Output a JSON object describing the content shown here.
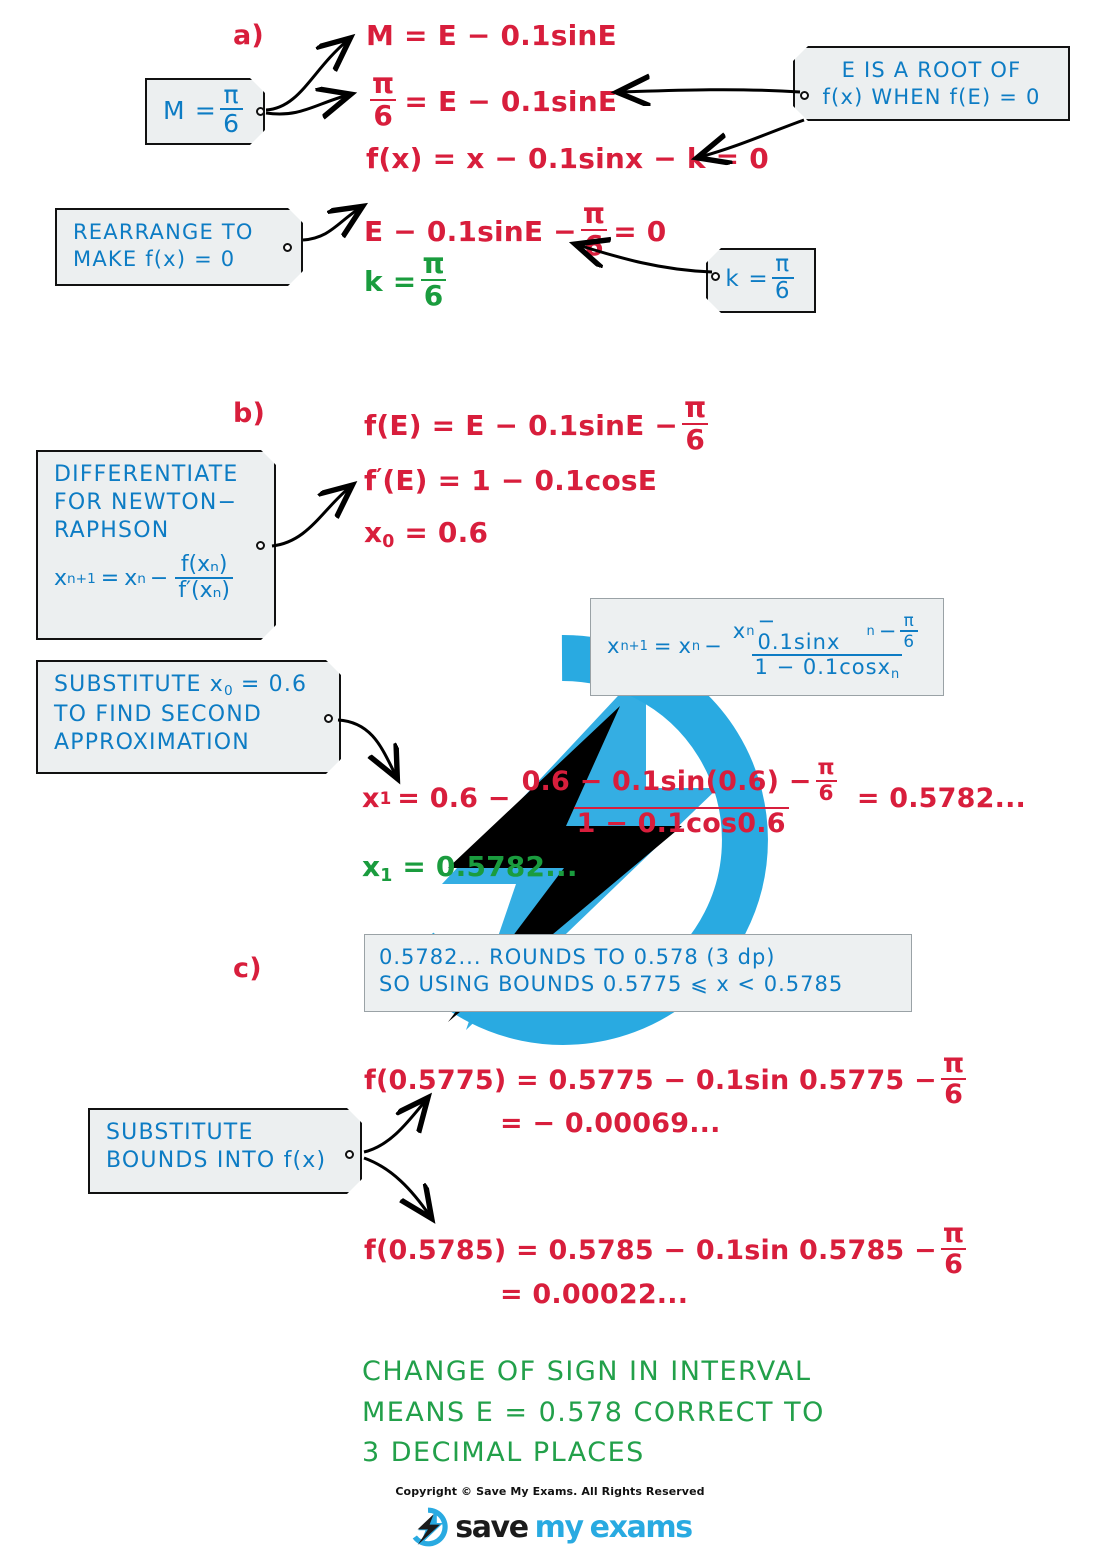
{
  "colors": {
    "working_red": "#d81e3c",
    "answer_green": "#1a9c3e",
    "note_blue": "#0d7cc4",
    "tag_fill": "#eceff0",
    "watermark_blue": "#29aae1",
    "watermark_black": "#000000"
  },
  "parts": {
    "a_label": "a)",
    "b_label": "b)",
    "c_label": "c)"
  },
  "part_a": {
    "tag_M": {
      "lhs": "M =",
      "num": "π",
      "den": "6"
    },
    "eq1": "M = E − 0.1sinE",
    "eq2": {
      "num": "π",
      "den": "6",
      "rhs": "= E − 0.1sinE"
    },
    "eq3": "f(x) = x − 0.1sinx − k = 0",
    "tag_root": {
      "line1": "E  IS  A  ROOT  OF",
      "line2": "f(x)  WHEN   f(E) = 0"
    },
    "tag_rearrange": {
      "line1": "REARRANGE   TO",
      "line2": "MAKE   f(x) = 0"
    },
    "eq4": {
      "lhs": "E − 0.1sinE −",
      "num": "π",
      "den": "6",
      "rhs": "= 0"
    },
    "eq5": {
      "lhs": "k =",
      "num": "π",
      "den": "6"
    },
    "tag_k": {
      "lhs": "k =",
      "num": "π",
      "den": "6"
    }
  },
  "part_b": {
    "eq_fE": {
      "lhs": "f(E) = E − 0.1sinE −",
      "num": "π",
      "den": "6"
    },
    "eq_fprime": {
      "lhs": "f",
      "prime": "′",
      "rest": "(E) = 1 − 0.1cosE"
    },
    "eq_x0": {
      "var": "x",
      "sub": "0",
      "rest": "= 0.6"
    },
    "tag_differentiate": {
      "line1": "DIFFERENTIATE",
      "line2": "FOR  NEWTON−",
      "line3": "RAPHSON",
      "formula": {
        "lhs_var": "x",
        "lhs_sub": "n+1",
        "eq": "=",
        "rhs_var": "x",
        "rhs_sub": "n",
        "minus": "−",
        "num": "f(xₙ)",
        "den": "f′(xₙ)"
      }
    },
    "tag_substitute": {
      "line1_a": "SUBSTITUTE   x",
      "line1_sub": "0",
      "line1_b": "= 0.6",
      "line2": "TO  FIND  SECOND",
      "line3": "APPROXIMATION"
    },
    "panel_nr": {
      "lhs_var": "x",
      "lhs_sub": "n+1",
      "eq": "=",
      "rhs_var": "x",
      "rhs_sub": "n",
      "minus": "−",
      "num_a": "x",
      "num_a_sub": "n",
      "num_b": "− 0.1sinx",
      "num_b_sub": "n",
      "num_c": "−",
      "num_pi": "π",
      "num_pi_den": "6",
      "den": "1 − 0.1cosx",
      "den_sub": "n"
    },
    "eq_x1": {
      "lhs_var": "x",
      "lhs_sub": "1",
      "lhs_rest": "= 0.6  −",
      "num_a": "0.6 − 0.1sin(0.6) −",
      "num_pi": "π",
      "num_pi_den": "6",
      "den": "1 − 0.1cos0.6",
      "rhs": "= 0.5782..."
    },
    "ans_x1": {
      "var": "x",
      "sub": "1",
      "rest": "= 0.5782..."
    }
  },
  "part_c": {
    "panel_bounds": {
      "line1": "0.5782...  ROUNDS   TO   0.578  (3 dp)",
      "line2": "SO  USING  BOUNDS   0.5775 ⩽ x < 0.5785"
    },
    "tag_bounds": {
      "line1": "SUBSTITUTE",
      "line2": "BOUNDS  INTO  f(x)"
    },
    "eq_lower": {
      "lhs": "f(0.5775) = 0.5775 − 0.1sin 0.5775 −",
      "num": "π",
      "den": "6"
    },
    "eq_lower_val": "= − 0.00069...",
    "eq_upper": {
      "lhs": "f(0.5785) = 0.5785 − 0.1sin 0.5785 −",
      "num": "π",
      "den": "6"
    },
    "eq_upper_val": "= 0.00022...",
    "conclusion": {
      "line1": "CHANGE  OF  SIGN  IN  INTERVAL",
      "line2": "MEANS  E = 0.578   CORRECT  TO",
      "line3": "3  DECIMAL  PLACES"
    }
  },
  "footer": {
    "copyright": "Copyright © Save My Exams. All Rights Reserved",
    "logo_part1": "save",
    "logo_part2": "my",
    "logo_part3": "exams"
  }
}
